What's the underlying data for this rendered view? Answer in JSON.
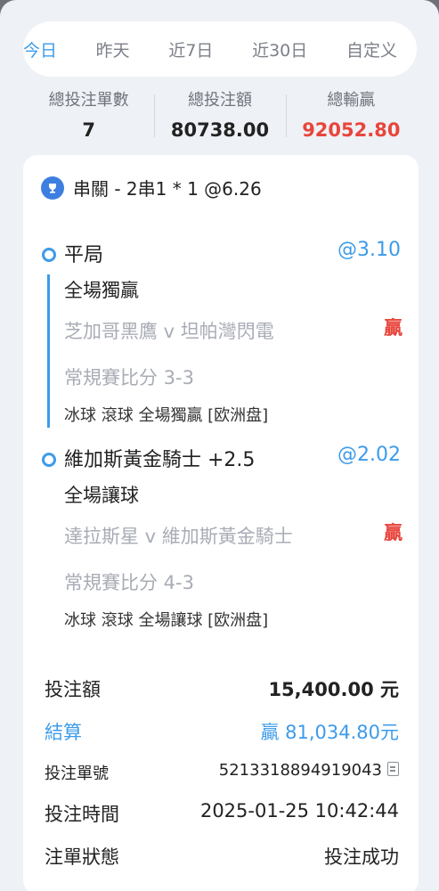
{
  "tabs": [
    {
      "label": "今日",
      "active": true
    },
    {
      "label": "昨天",
      "active": false
    },
    {
      "label": "近7日",
      "active": false
    },
    {
      "label": "近30日",
      "active": false
    },
    {
      "label": "自定义",
      "active": false
    }
  ],
  "summary": {
    "count_label": "總投注單數",
    "count_value": "7",
    "amount_label": "總投注額",
    "amount_value": "80738.00",
    "winloss_label": "總輸贏",
    "winloss_value": "92052.80"
  },
  "bet": {
    "title": "串關 - 2串1 * 1 @6.26",
    "legs": [
      {
        "pick": "平局",
        "odds": "@3.10",
        "market": "全場獨贏",
        "match": "芝加哥黑鷹 v 坦帕灣閃電",
        "result": "贏",
        "score": "常規賽比分 3-3",
        "meta": "冰球 滾球   全場獨贏 [欧洲盘]"
      },
      {
        "pick": "維加斯黃金騎士 +2.5",
        "odds": "@2.02",
        "market": "全場讓球",
        "match": "達拉斯星 v 維加斯黃金騎士",
        "result": "贏",
        "score": "常規賽比分 4-3",
        "meta": "冰球 滾球   全場讓球 [欧洲盘]"
      }
    ],
    "details": {
      "stake_label": "投注額",
      "stake_value": "15,400.00 元",
      "settle_label": "結算",
      "settle_value": "贏 81,034.80元",
      "id_label": "投注單號",
      "id_value": "5213318894919043",
      "time_label": "投注時間",
      "time_value": "2025-01-25 10:42:44",
      "status_label": "注單狀態",
      "status_value": "投注成功"
    }
  },
  "colors": {
    "accent": "#3d9be9",
    "win": "#e8453c"
  },
  "icons": {
    "title": "trophy-icon",
    "copy": "copy-icon"
  }
}
